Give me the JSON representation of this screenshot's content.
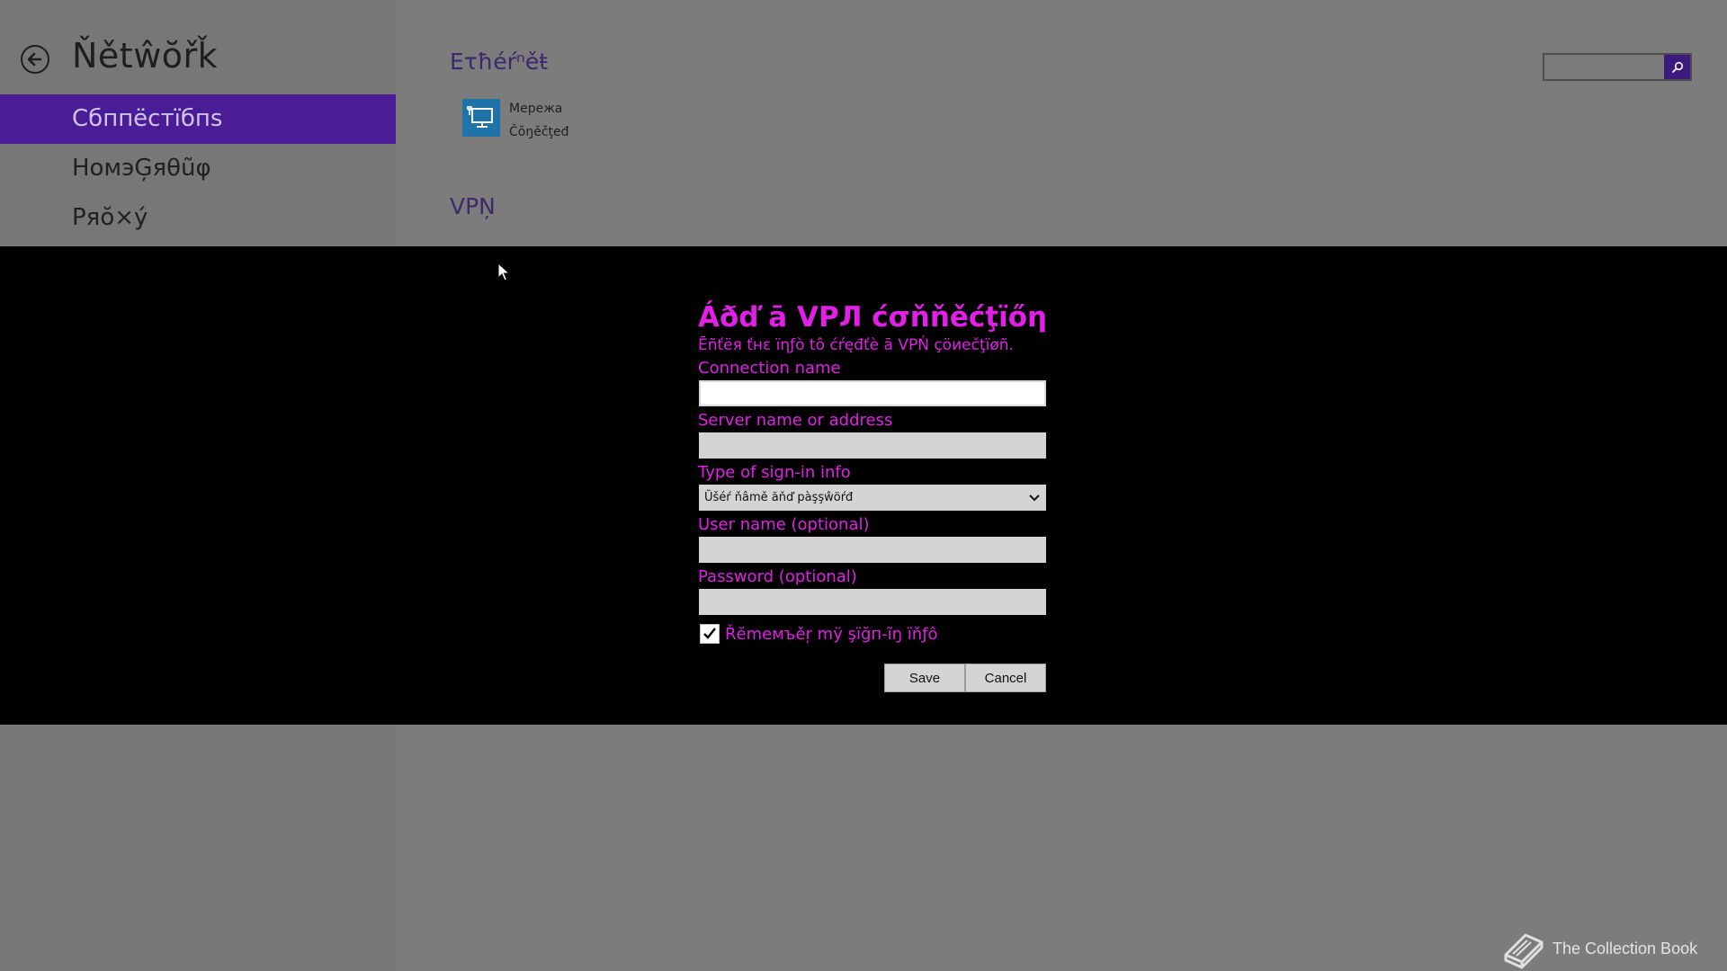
{
  "nav": {
    "title": "Ňětŵŏřǩ",
    "items": [
      {
        "label": "Сбппёстїбпѕ",
        "selected": true
      },
      {
        "label": "НомэĢяθũφ",
        "selected": false
      },
      {
        "label": "Ряŏ×ý",
        "selected": false
      }
    ]
  },
  "content": {
    "ethernet_heading": "Ετħéŕⁿěŧ",
    "network": {
      "name": "Мережа",
      "status": "Čŏŋěčţеđ",
      "icon": "monitor-network-icon"
    },
    "vpn_heading": "VPŅ",
    "search": {
      "placeholder": "",
      "value": ""
    }
  },
  "dialog": {
    "title": "Áðď ā VPЛ ćσňňěćţïőη",
    "subtitle": "Ēñťёя ťнε ïηƒò tô ćŕęđťè ā VPŃ çöиеčţïøñ.",
    "fields": {
      "connection_name": {
        "label": "Connection name",
        "value": ""
      },
      "server": {
        "label": "Server name or address",
        "value": ""
      },
      "signin_type": {
        "label": "Type of sign-in info",
        "value": "Ŭšéŕ ňâmě ăňď pàşşŵöŕđ"
      },
      "username": {
        "label": "User name (optional)",
        "value": ""
      },
      "password": {
        "label": "Password (optional)",
        "value": ""
      }
    },
    "remember": {
      "label": "Řĕmeмъěŗ mÿ şïğп-ĩŋ ïňƒô",
      "checked": true
    },
    "buttons": {
      "save": "Save",
      "cancel": "Cancel"
    }
  },
  "watermark": {
    "text": "The Collection Book",
    "icon": "book-icon"
  },
  "colors": {
    "accent_purple": "#4a1d96",
    "dialog_text": "#e21fe6",
    "dialog_background": "#000000",
    "page_background": "#7c7c7c"
  }
}
